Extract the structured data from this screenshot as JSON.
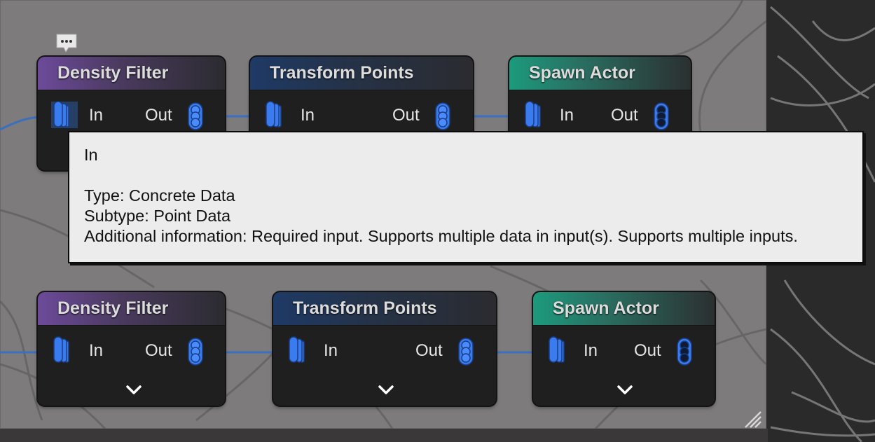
{
  "nodes": {
    "row1": [
      {
        "title": "Density Filter",
        "in_label": "In",
        "out_label": "Out",
        "header_style": "filter"
      },
      {
        "title": "Transform Points",
        "in_label": "In",
        "out_label": "Out",
        "header_style": "transform"
      },
      {
        "title": "Spawn Actor",
        "in_label": "In",
        "out_label": "Out",
        "header_style": "spawn"
      }
    ],
    "row2": [
      {
        "title": "Density Filter",
        "in_label": "In",
        "out_label": "Out",
        "header_style": "filter"
      },
      {
        "title": "Transform Points",
        "in_label": "In",
        "out_label": "Out",
        "header_style": "transform"
      },
      {
        "title": "Spawn Actor",
        "in_label": "In",
        "out_label": "Out",
        "header_style": "spawn"
      }
    ]
  },
  "tooltip": {
    "title": "In",
    "type_line": "Type: Concrete Data",
    "subtype_line": "Subtype: Point Data",
    "info_line": "Additional information: Required input. Supports multiple data in input(s). Supports multiple inputs."
  },
  "colors": {
    "pin_blue": "#3a7bf0",
    "wire_blue": "#3b6fbf",
    "comment_bg": "#7d7b7b",
    "tooltip_bg": "#ececec"
  },
  "icons": {
    "comment": "speech-bubble-ellipsis-icon",
    "in_pin": "multi-data-pin-icon",
    "out_pin": "stacked-data-pin-icon",
    "expand": "chevron-down-icon",
    "resize": "resize-grip-icon"
  }
}
